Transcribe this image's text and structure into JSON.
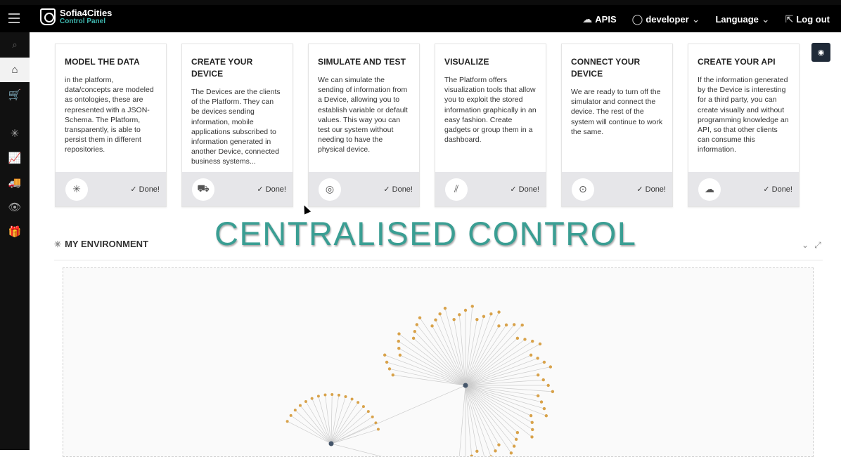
{
  "app": {
    "name": "Sofia4Cities",
    "subtitle": "Control Panel"
  },
  "topnav": {
    "apis": "APIS",
    "user": "developer",
    "language": "Language",
    "logout": "Log out"
  },
  "sidebar": {
    "items": [
      {
        "icon": "search-icon",
        "glyph": "⌕"
      },
      {
        "icon": "home-icon",
        "glyph": "⌂"
      },
      {
        "icon": "marketplace-icon",
        "glyph": "🛒"
      },
      {
        "icon": "network-icon",
        "glyph": "✳"
      },
      {
        "icon": "chart-icon",
        "glyph": "📈"
      },
      {
        "icon": "truck-icon",
        "glyph": "🚚"
      },
      {
        "icon": "eye-icon",
        "glyph": "👁"
      },
      {
        "icon": "box-icon",
        "glyph": "🎁"
      }
    ]
  },
  "cards": [
    {
      "title": "MODEL THE DATA",
      "text": "in the platform, data/concepts are modeled as ontologies, these are represented with a JSON-Schema. The Platform, transparently, is able to persist them in different repositories.",
      "icon": "network-icon",
      "glyph": "✳",
      "done": "✓ Done!"
    },
    {
      "title": "CREATE YOUR DEVICE",
      "text": "The Devices are the clients of the Platform. They can be devices sending information, mobile applications subscribed to information generated in another Device, connected business systems...",
      "icon": "truck-icon",
      "glyph": "⛟",
      "done": "✓ Done!"
    },
    {
      "title": "SIMULATE AND TEST",
      "text": "We can simulate the sending of information from a Device, allowing you to establish variable or default values. This way you can test our system without needing to have the physical device.",
      "icon": "radar-icon",
      "glyph": "◎",
      "done": "✓ Done!"
    },
    {
      "title": "VISUALIZE",
      "text": "The Platform offers visualization tools that allow you to exploit the stored information graphically in an easy fashion. Create gadgets or group them in a dashboard.",
      "icon": "chart-icon",
      "glyph": "⫽",
      "done": "✓ Done!"
    },
    {
      "title": "CONNECT YOUR DEVICE",
      "text": "We are ready to turn off the simulator and connect the device. The rest of the system will continue to work the same.",
      "icon": "toggle-icon",
      "glyph": "⊙",
      "done": "✓ Done!"
    },
    {
      "title": "CREATE YOUR API",
      "text": "If the information generated by the Device is interesting for a third party, you can create visually and without programming knowledge an API, so that other clients can consume this information.",
      "icon": "cloud-icon",
      "glyph": "☁",
      "done": "✓ Done!"
    }
  ],
  "environment": {
    "title": "MY ENVIRONMENT"
  },
  "overlay": {
    "text": "CENTRALISED CONTROL"
  },
  "colors": {
    "accent": "#3fb6ae",
    "node_orange": "#d8a24a",
    "node_dark": "#44556a",
    "node_blue": "#3a6fb5"
  }
}
